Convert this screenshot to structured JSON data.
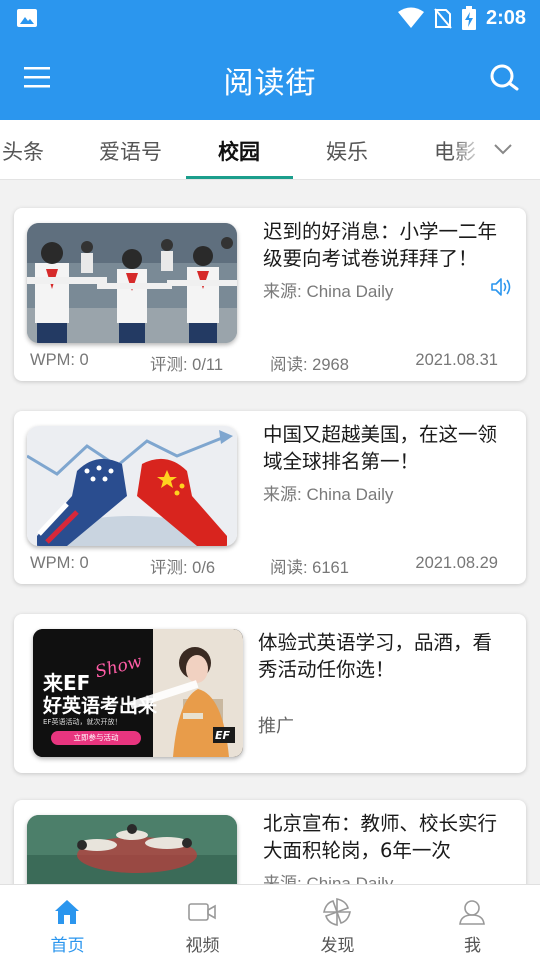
{
  "status_bar": {
    "time": "2:08",
    "icons": [
      "gallery-icon",
      "wifi-icon",
      "no-sim-icon",
      "battery-charging-icon"
    ]
  },
  "app_bar": {
    "title": "阅读街",
    "menu_icon": "hamburger-menu-icon",
    "search_icon": "search-icon"
  },
  "tabs": {
    "items": [
      {
        "label": "头条"
      },
      {
        "label": "爱语号"
      },
      {
        "label": "校园",
        "active": true
      },
      {
        "label": "娱乐"
      },
      {
        "label": "电影"
      }
    ],
    "expand_icon": "chevron-down-icon",
    "accent": "#1b9e8c"
  },
  "articles": [
    {
      "title": "迟到的好消息：小学一二年级要向考试卷说拜拜了！",
      "source": "来源: China Daily",
      "wpm": "WPM: 0",
      "review": "评测: 0/11",
      "reads": "阅读: 2968",
      "date": "2021.08.31",
      "has_audio": true
    },
    {
      "title": "中国又超越美国，在这一领域全球排名第一！",
      "source": "来源: China Daily",
      "wpm": "WPM: 0",
      "review": "评测: 0/6",
      "reads": "阅读: 6161",
      "date": "2021.08.29"
    },
    {
      "title": "体验式英语学习，品酒，看秀活动任你选！",
      "tag": "推广",
      "ad_image_text": {
        "line1": "来EF",
        "script": "Show",
        "line2": "好英语考出来",
        "small": "EF英语活动，就次开放！",
        "button": "立即参与活动",
        "logo": "EF"
      }
    },
    {
      "title": "北京宣布：教师、校长实行大面积轮岗，6年一次",
      "source": "来源: China Daily"
    }
  ],
  "bottom_nav": {
    "items": [
      {
        "label": "首页",
        "icon": "home-icon",
        "active": true
      },
      {
        "label": "视频",
        "icon": "video-icon"
      },
      {
        "label": "发现",
        "icon": "discover-icon"
      },
      {
        "label": "我",
        "icon": "profile-icon"
      }
    ],
    "active_color": "#2b96ee"
  },
  "colors": {
    "primary": "#2b96ee",
    "tab_accent": "#1b9e8c",
    "background": "#f2f2f2"
  }
}
